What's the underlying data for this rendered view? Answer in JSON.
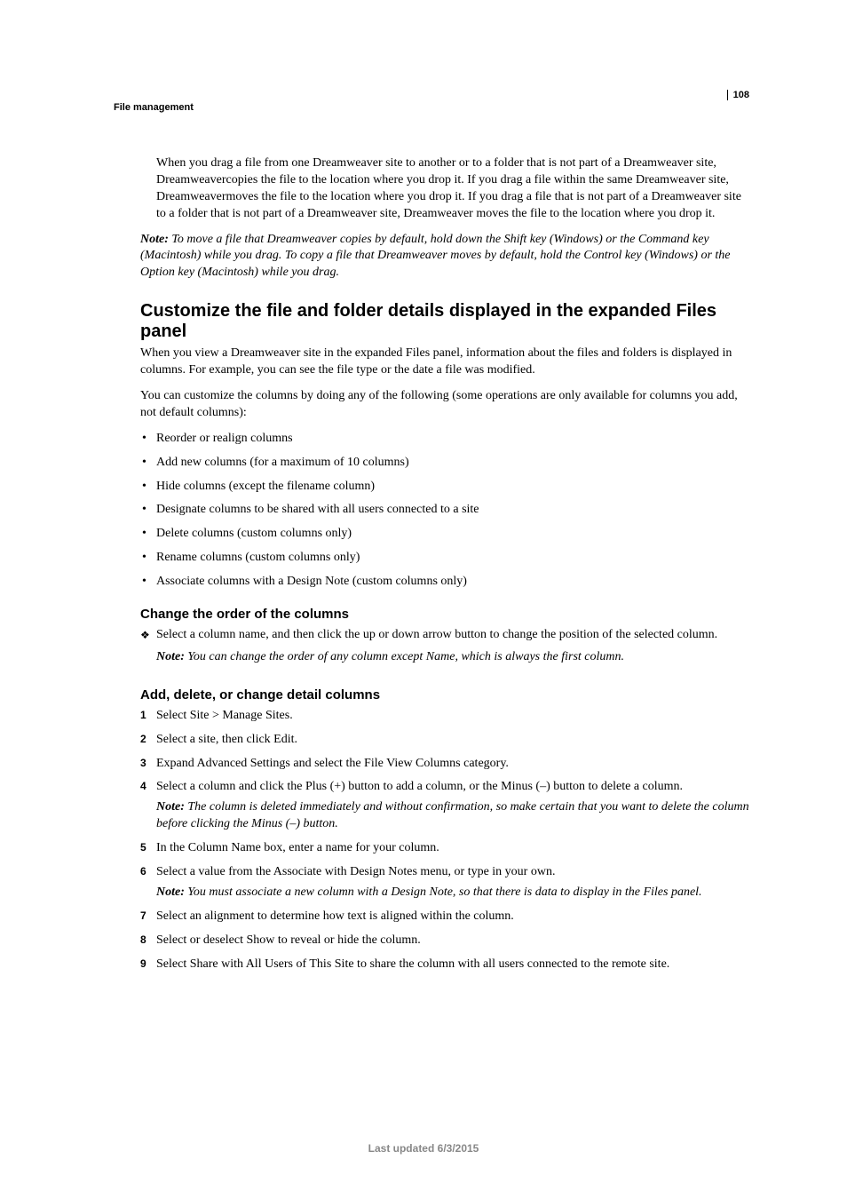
{
  "header": {
    "section": "File management",
    "page_number": "108"
  },
  "intro": {
    "paragraph": "When you drag a file from one Dreamweaver site to another or to a folder that is not part of a Dreamweaver site, Dreamweavercopies the file to the location where you drop it. If you drag a file within the same Dreamweaver site, Dreamweavermoves the file to the location where you drop it. If you drag a file that is not part of a Dreamweaver site to a folder that is not part of a Dreamweaver site, Dreamweaver moves the file to the location where you drop it."
  },
  "top_note": {
    "label": "Note: ",
    "text": "To move a file that Dreamweaver copies by default, hold down the Shift key (Windows) or the Command key (Macintosh) while you drag. To copy a file that Dreamweaver moves by default, hold the Control key (Windows) or the Option key (Macintosh) while you drag."
  },
  "main_heading": "Customize the file and folder details displayed in the expanded Files panel",
  "section_p1": "When you view a Dreamweaver site in the expanded Files panel, information about the files and folders is displayed in columns. For example, you can see the file type or the date a file was modified.",
  "section_p2": "You can customize the columns by doing any of the following (some operations are only available for columns you add, not default columns):",
  "bullets": [
    "Reorder or realign columns",
    "Add new columns (for a maximum of 10 columns)",
    "Hide columns (except the filename column)",
    "Designate columns to be shared with all users connected to a site",
    "Delete columns (custom columns only)",
    "Rename columns (custom columns only)",
    "Associate columns with a Design Note (custom columns only)"
  ],
  "sub1": {
    "heading": "Change the order of the columns",
    "item_text": "Select a column name, and then click the up or down arrow button to change the position of the selected column.",
    "note_label": "Note: ",
    "note_text": "You can change the order of any column except Name, which is always the first column."
  },
  "sub2": {
    "heading": "Add, delete, or change detail columns",
    "steps": [
      {
        "text": "Select Site > Manage Sites."
      },
      {
        "text": "Select a site, then click Edit."
      },
      {
        "text": "Expand Advanced Settings and select the File View Columns category."
      },
      {
        "text": "Select a column and click the Plus (+) button to add a column, or the Minus (–) button to delete a column.",
        "note_label": "Note: ",
        "note_text": "The column is deleted immediately and without confirmation, so make certain that you want to delete the column before clicking the Minus (–) button."
      },
      {
        "text": "In the Column Name box, enter a name for your column."
      },
      {
        "text": "Select a value from the Associate with Design Notes menu, or type in your own.",
        "note_label": "Note: ",
        "note_text": "You must associate a new column with a Design Note, so that there is data to display in the Files panel."
      },
      {
        "text": "Select an alignment to determine how text is aligned within the column."
      },
      {
        "text": "Select or deselect Show to reveal or hide the column."
      },
      {
        "text": "Select Share with All Users of This Site to share the column with all users connected to the remote site."
      }
    ]
  },
  "footer": "Last updated 6/3/2015"
}
